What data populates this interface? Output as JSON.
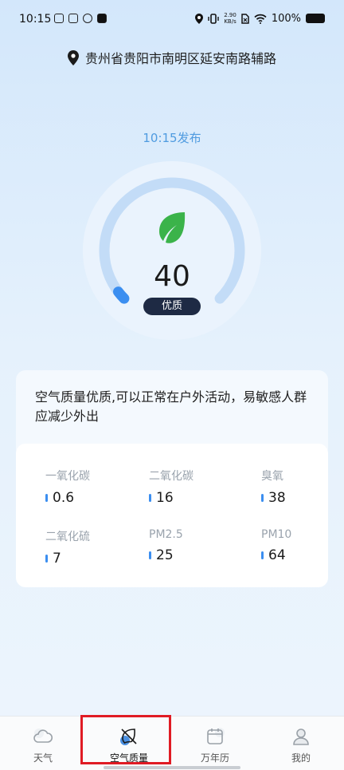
{
  "status_bar": {
    "time": "10:15",
    "net_speed_top": "2.90",
    "net_speed_unit": "KB/s",
    "battery": "100%"
  },
  "location": {
    "icon": "location-pin-icon",
    "text": "贵州省贵阳市南明区延安南路辅路"
  },
  "air": {
    "publish_time": "10:15发布",
    "aqi": 40,
    "aqi_text": "40",
    "aqi_max": 500,
    "level": "优质",
    "icon": "leaf-icon",
    "accent": "#3b8ef0",
    "leaf_color": "#3bb34a",
    "description": "空气质量优质,可以正常在户外活动，易敏感人群应减少外出"
  },
  "pollutants": [
    {
      "name": "一氧化碳",
      "value": "0.6"
    },
    {
      "name": "二氧化碳",
      "value": "16"
    },
    {
      "name": "臭氧",
      "value": "38"
    },
    {
      "name": "二氧化硫",
      "value": "7"
    },
    {
      "name": "PM2.5",
      "value": "25"
    },
    {
      "name": "PM10",
      "value": "64"
    }
  ],
  "tabs": [
    {
      "label": "天气",
      "icon": "cloud-icon"
    },
    {
      "label": "空气质量",
      "icon": "leaf-slash-icon",
      "active": true
    },
    {
      "label": "万年历",
      "icon": "calendar-icon"
    },
    {
      "label": "我的",
      "icon": "user-icon"
    }
  ]
}
